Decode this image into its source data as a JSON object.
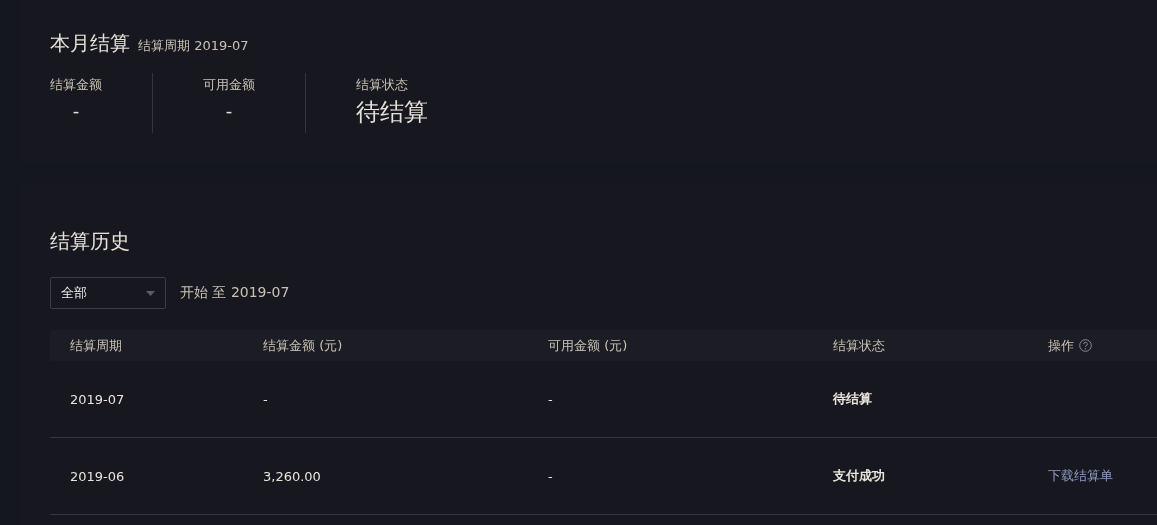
{
  "current": {
    "title": "本月结算",
    "period_label": "结算周期 2019-07",
    "stats": [
      {
        "label": "结算金额",
        "value": "-",
        "kind": "amount"
      },
      {
        "label": "可用金额",
        "value": "-",
        "kind": "amount"
      },
      {
        "label": "结算状态",
        "value": "待结算",
        "kind": "status"
      }
    ]
  },
  "history": {
    "title": "结算历史",
    "filter": {
      "value": "全部"
    },
    "range": "开始 至 2019-07",
    "table": {
      "columns": [
        {
          "label": "结算周期"
        },
        {
          "label": "结算金额 (元)"
        },
        {
          "label": "可用金额 (元)"
        },
        {
          "label": "结算状态"
        },
        {
          "label": "操作",
          "help": true
        }
      ],
      "rows": [
        {
          "period": "2019-07",
          "amount": "-",
          "available": "-",
          "status": "待结算"
        },
        {
          "period": "2019-06",
          "amount": "3,260.00",
          "available": "-",
          "status": "支付成功",
          "action": "下载结算单"
        }
      ]
    }
  }
}
